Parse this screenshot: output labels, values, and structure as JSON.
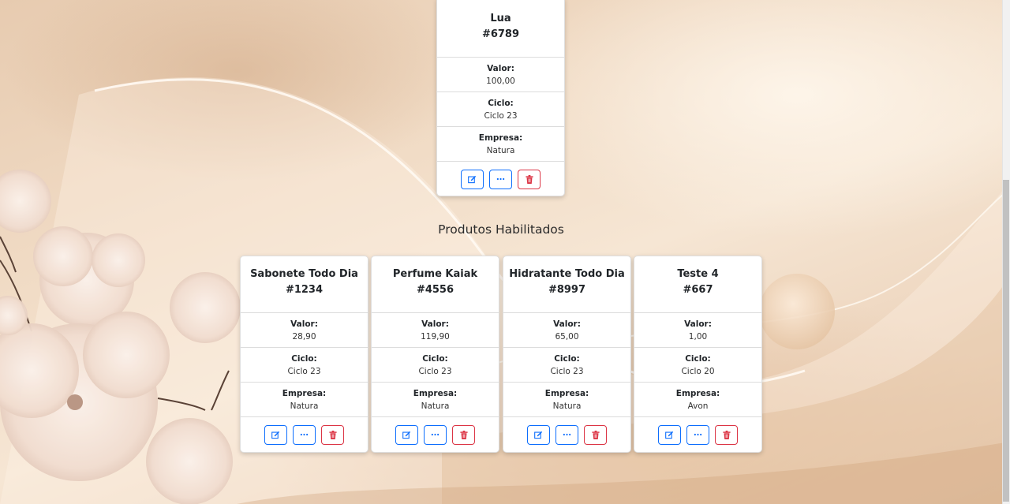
{
  "colors": {
    "edit_button_border": "#0d6efd",
    "more_button_border": "#0d6efd",
    "delete_button_border": "#dc3545",
    "card_background": "#ffffff"
  },
  "icons": {
    "edit": "pencil-square-icon",
    "more": "three-dots-icon",
    "delete": "trash-icon"
  },
  "top_product": {
    "name": "Lua",
    "code": "#6789",
    "valor_label": "Valor:",
    "valor": "100,00",
    "ciclo_label": "Ciclo:",
    "ciclo": "Ciclo 23",
    "empresa_label": "Empresa:",
    "empresa": "Natura"
  },
  "section": {
    "title": "Produtos Habilitados"
  },
  "products": [
    {
      "name": "Sabonete Todo Dia",
      "code": "#1234",
      "valor_label": "Valor:",
      "valor": "28,90",
      "ciclo_label": "Ciclo:",
      "ciclo": "Ciclo 23",
      "empresa_label": "Empresa:",
      "empresa": "Natura"
    },
    {
      "name": "Perfume Kaiak",
      "code": "#4556",
      "valor_label": "Valor:",
      "valor": "119,90",
      "ciclo_label": "Ciclo:",
      "ciclo": "Ciclo 23",
      "empresa_label": "Empresa:",
      "empresa": "Natura"
    },
    {
      "name": "Hidratante Todo Dia",
      "code": "#8997",
      "valor_label": "Valor:",
      "valor": "65,00",
      "ciclo_label": "Ciclo:",
      "ciclo": "Ciclo 23",
      "empresa_label": "Empresa:",
      "empresa": "Natura"
    },
    {
      "name": "Teste 4",
      "code": "#667",
      "valor_label": "Valor:",
      "valor": "1,00",
      "ciclo_label": "Ciclo:",
      "ciclo": "Ciclo 20",
      "empresa_label": "Empresa:",
      "empresa": "Avon"
    }
  ]
}
